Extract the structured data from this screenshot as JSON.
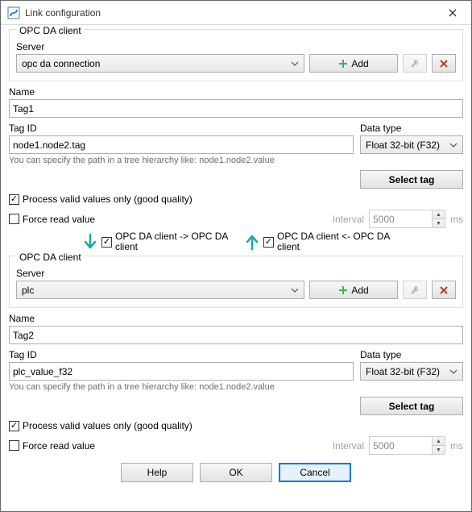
{
  "window": {
    "title": "Link configuration"
  },
  "client1": {
    "group": "OPC DA client",
    "server_label": "Server",
    "server_value": "opc da connection",
    "add_label": "Add",
    "name_label": "Name",
    "name_value": "Tag1",
    "tagid_label": "Tag ID",
    "tagid_value": "node1.node2.tag",
    "datatype_label": "Data type",
    "datatype_value": "Float 32-bit (F32)",
    "hint": "You can specify the path in a tree hierarchy like: node1.node2.value",
    "select_tag": "Select tag",
    "process_valid": "Process valid values only (good quality)",
    "force_read": "Force read value",
    "interval_label": "Interval",
    "interval_value": "5000",
    "interval_unit": "ms"
  },
  "direction": {
    "down_label": "OPC DA client -> OPC DA client",
    "up_label": "OPC DA client <- OPC DA client"
  },
  "client2": {
    "group": "OPC DA client",
    "server_label": "Server",
    "server_value": "plc",
    "add_label": "Add",
    "name_label": "Name",
    "name_value": "Tag2",
    "tagid_label": "Tag ID",
    "tagid_value": "plc_value_f32",
    "datatype_label": "Data type",
    "datatype_value": "Float 32-bit (F32)",
    "hint": "You can specify the path in a tree hierarchy like: node1.node2.value",
    "select_tag": "Select tag",
    "process_valid": "Process valid values only (good quality)",
    "force_read": "Force read value",
    "interval_label": "Interval",
    "interval_value": "5000",
    "interval_unit": "ms"
  },
  "buttons": {
    "help": "Help",
    "ok": "OK",
    "cancel": "Cancel"
  },
  "colors": {
    "accent": "#0078d7",
    "teal": "#1aa7a7",
    "green": "#3fb05a",
    "red": "#c0392b",
    "gray_disabled": "#a0a0a0"
  }
}
